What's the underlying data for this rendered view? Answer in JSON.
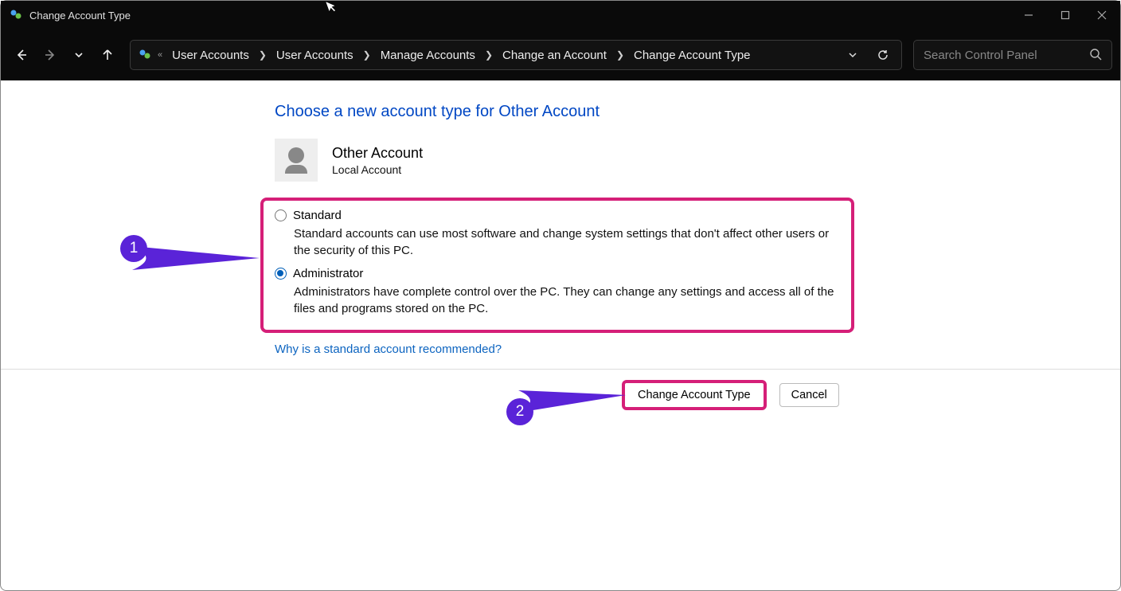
{
  "window": {
    "title": "Change Account Type"
  },
  "breadcrumb": {
    "items": [
      {
        "label": "User Accounts"
      },
      {
        "label": "User Accounts"
      },
      {
        "label": "Manage Accounts"
      },
      {
        "label": "Change an Account"
      },
      {
        "label": "Change Account Type"
      }
    ]
  },
  "search": {
    "placeholder": "Search Control Panel"
  },
  "page": {
    "heading": "Choose a new account type for Other Account",
    "account": {
      "name": "Other Account",
      "type": "Local Account"
    },
    "options": [
      {
        "id": "standard",
        "label": "Standard",
        "description": "Standard accounts can use most software and change system settings that don't affect other users or the security of this PC.",
        "selected": false
      },
      {
        "id": "administrator",
        "label": "Administrator",
        "description": "Administrators have complete control over the PC. They can change any settings and access all of the files and programs stored on the PC.",
        "selected": true
      }
    ],
    "help_link": "Why is a standard account recommended?",
    "buttons": {
      "primary": "Change Account Type",
      "cancel": "Cancel"
    }
  },
  "annotations": {
    "step1": "1",
    "step2": "2"
  }
}
